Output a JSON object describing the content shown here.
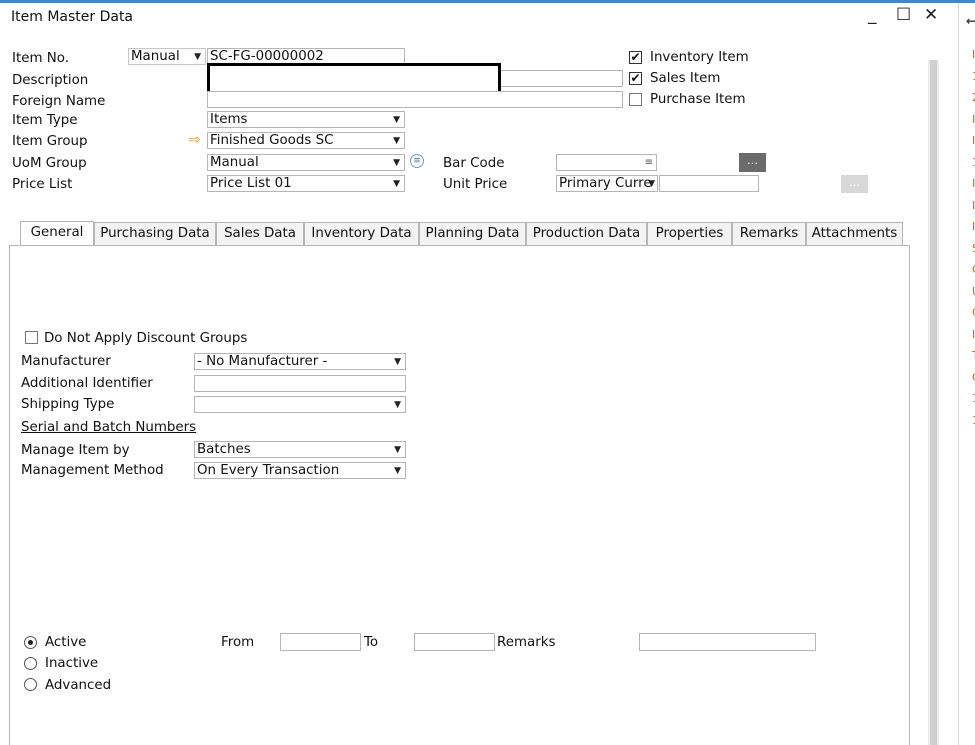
{
  "window": {
    "title": "Item Master Data",
    "minimize": "_",
    "maximize": "☐",
    "close": "✕"
  },
  "header": {
    "item_no_label": "Item No.",
    "item_no_series": "Manual",
    "item_no_value": "SC-FG-00000002",
    "description_label": "Description",
    "description_value": "",
    "foreign_name_label": "Foreign Name",
    "foreign_name_value": "",
    "item_type_label": "Item Type",
    "item_type_value": "Items",
    "item_group_label": "Item Group",
    "item_group_value": "Finished Goods SC",
    "uom_group_label": "UoM Group",
    "uom_group_value": "Manual",
    "price_list_label": "Price List",
    "price_list_value": "Price List 01",
    "bar_code_label": "Bar Code",
    "bar_code_value": "",
    "unit_price_label": "Unit Price",
    "unit_price_currency": "Primary Curre",
    "unit_price_value": "",
    "inventory_item_label": "Inventory Item",
    "inventory_item_checked": true,
    "sales_item_label": "Sales Item",
    "sales_item_checked": true,
    "purchase_item_label": "Purchase Item",
    "purchase_item_checked": false
  },
  "tabs": [
    {
      "label": "General",
      "active": true
    },
    {
      "label": "Purchasing Data"
    },
    {
      "label": "Sales Data"
    },
    {
      "label": "Inventory Data"
    },
    {
      "label": "Planning Data"
    },
    {
      "label": "Production Data"
    },
    {
      "label": "Properties"
    },
    {
      "label": "Remarks"
    },
    {
      "label": "Attachments"
    }
  ],
  "general": {
    "no_discount_label": "Do Not Apply Discount Groups",
    "manufacturer_label": "Manufacturer",
    "manufacturer_value": "- No Manufacturer -",
    "additional_identifier_label": "Additional Identifier",
    "additional_identifier_value": "",
    "shipping_type_label": "Shipping Type",
    "shipping_type_value": "",
    "serial_batch_link": "Serial and Batch Numbers",
    "manage_item_by_label": "Manage Item by",
    "manage_item_by_value": "Batches",
    "management_method_label": "Management Method",
    "management_method_value": "On Every Transaction",
    "active_label": "Active",
    "inactive_label": "Inactive",
    "advanced_label": "Advanced",
    "status_selected": "Active",
    "from_label": "From",
    "to_label": "To",
    "remarks_label": "Remarks"
  },
  "colors": {
    "accent": "#3c87d8",
    "arrow": "#f0a020",
    "button_dark": "#6b6b6b"
  },
  "right_pane_chars": [
    "I",
    "1",
    "2",
    "I",
    "I",
    "1",
    "I",
    "I",
    "I",
    "S",
    "C",
    "U",
    "C",
    "I",
    "T",
    "C",
    "1",
    "1"
  ]
}
